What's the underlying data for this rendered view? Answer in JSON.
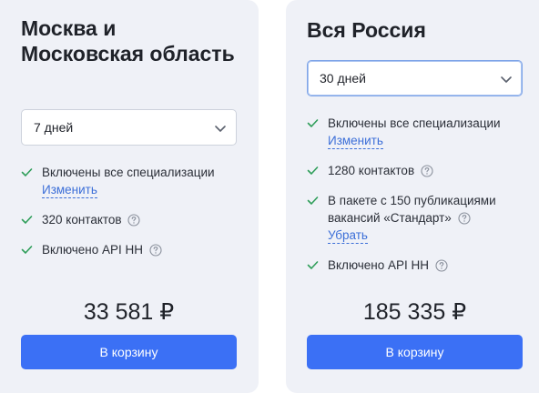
{
  "cards": [
    {
      "title": "Москва и Московская область",
      "period": "7 дней",
      "features": [
        {
          "text": "Включены все специализации",
          "link": "Изменить",
          "has_info": false
        },
        {
          "text": "320 контактов",
          "link": null,
          "has_info": true
        },
        {
          "text": "Включено API HH",
          "link": null,
          "has_info": true
        }
      ],
      "price": "33 581 ₽",
      "button": "В корзину"
    },
    {
      "title": "Вся Россия",
      "period": "30 дней",
      "features": [
        {
          "text": "Включены все специализации",
          "link": "Изменить",
          "has_info": false
        },
        {
          "text": "1280 контактов",
          "link": null,
          "has_info": true
        },
        {
          "text": "В пакете с 150 публикациями вакансий «Стандарт»",
          "link": "Убрать",
          "has_info": true
        },
        {
          "text": "Включено API HH",
          "link": null,
          "has_info": true
        }
      ],
      "price": "185 335 ₽",
      "button": "В корзину"
    }
  ],
  "colors": {
    "card_bg": "#eff1f7",
    "accent": "#3b70f5",
    "link": "#3c6fd8",
    "check": "#2f9e5a",
    "text": "#1f2229"
  },
  "icons": {
    "check": "check-icon",
    "info": "question-circle-icon",
    "dropdown": "chevron-down-icon"
  }
}
